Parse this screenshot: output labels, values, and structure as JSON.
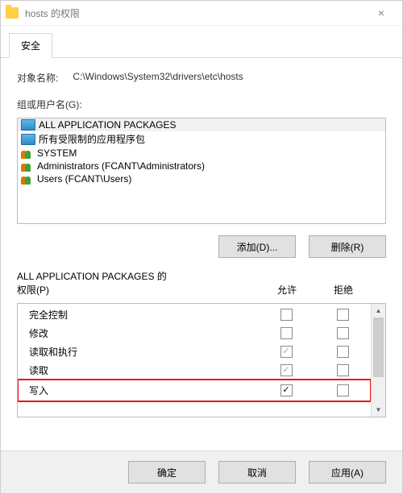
{
  "window": {
    "title": "hosts 的权限",
    "close_label": "×"
  },
  "tabs": {
    "security": "安全"
  },
  "object_name_label": "对象名称:",
  "object_name_value": "C:\\Windows\\System32\\drivers\\etc\\hosts",
  "groups_label": "组或用户名(G):",
  "groups": {
    "items": [
      {
        "label": "ALL APPLICATION PACKAGES",
        "icon": "pc",
        "selected": true
      },
      {
        "label": "所有受限制的应用程序包",
        "icon": "pc",
        "selected": false
      },
      {
        "label": "SYSTEM",
        "icon": "users",
        "selected": false
      },
      {
        "label": "Administrators (FCANT\\Administrators)",
        "icon": "users",
        "selected": false
      },
      {
        "label": "Users (FCANT\\Users)",
        "icon": "users",
        "selected": false
      }
    ]
  },
  "buttons": {
    "add": "添加(D)...",
    "remove": "删除(R)",
    "ok": "确定",
    "cancel": "取消",
    "apply": "应用(A)"
  },
  "perm_header_prefix": "ALL APPLICATION PACKAGES 的",
  "perm_header_suffix": "权限(P)",
  "perm_cols": {
    "allow": "允许",
    "deny": "拒绝"
  },
  "permissions": [
    {
      "label": "完全控制",
      "allow": "unchecked",
      "deny": "unchecked",
      "highlight": false
    },
    {
      "label": "修改",
      "allow": "unchecked",
      "deny": "unchecked",
      "highlight": false
    },
    {
      "label": "读取和执行",
      "allow": "checked-gray",
      "deny": "unchecked",
      "highlight": false
    },
    {
      "label": "读取",
      "allow": "checked-gray",
      "deny": "unchecked",
      "highlight": false
    },
    {
      "label": "写入",
      "allow": "checked",
      "deny": "unchecked",
      "highlight": true
    }
  ]
}
